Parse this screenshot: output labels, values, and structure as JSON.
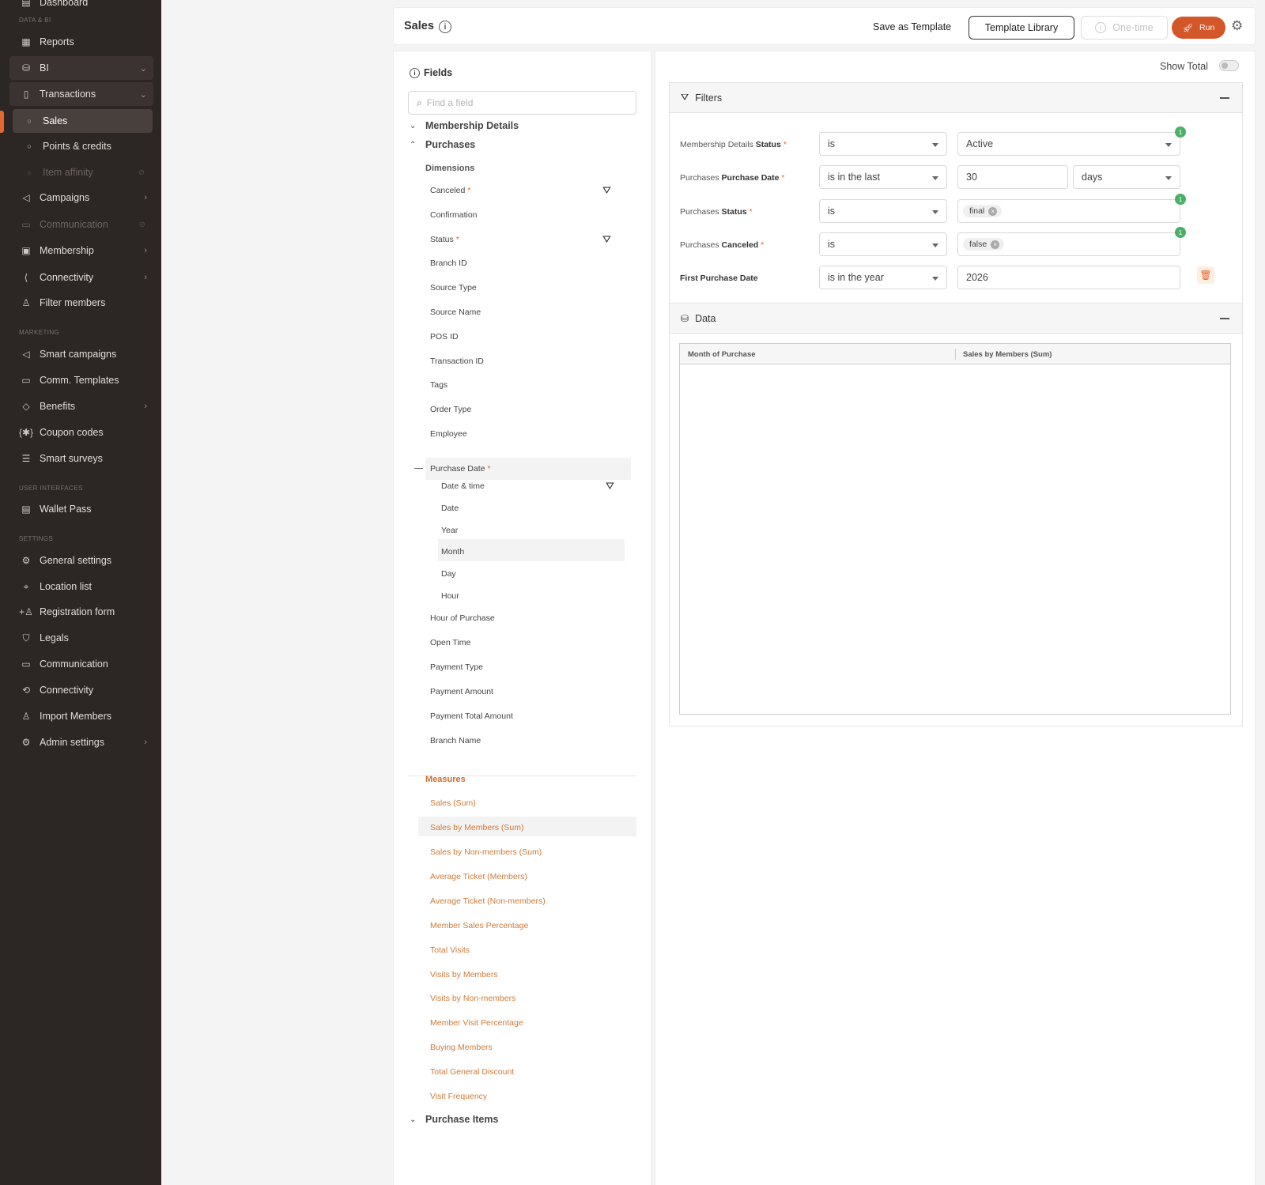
{
  "sidebar": {
    "top_item": "Dashboard",
    "sections": {
      "data_bi": "DATA & BI",
      "marketing": "MARKETING",
      "user_interfaces": "USER INTERFACES",
      "settings": "SETTINGS"
    },
    "items": {
      "reports": "Reports",
      "bi": "BI",
      "transactions": "Transactions",
      "sales": "Sales",
      "points_credits": "Points & credits",
      "item_affinity": "Item affinity",
      "campaigns": "Campaigns",
      "communication_bi": "Communication",
      "membership": "Membership",
      "connectivity_bi": "Connectivity",
      "filter_members": "Filter members",
      "smart_campaigns": "Smart campaigns",
      "comm_templates": "Comm. Templates",
      "benefits": "Benefits",
      "coupon_codes": "Coupon codes",
      "smart_surveys": "Smart surveys",
      "wallet_pass": "Wallet Pass",
      "general_settings": "General settings",
      "location_list": "Location list",
      "registration_form": "Registration form",
      "legals": "Legals",
      "communication": "Communication",
      "connectivity": "Connectivity",
      "import_members": "Import Members",
      "admin_settings": "Admin settings"
    },
    "accent_color": "#e0692f"
  },
  "header": {
    "title": "Sales",
    "save_template": "Save as Template",
    "template_library": "Template Library",
    "one_time": "One-time",
    "run": "Run"
  },
  "fields": {
    "title": "Fields",
    "search_placeholder": "Find a field",
    "groups": {
      "membership_details": "Membership Details",
      "purchases": "Purchases",
      "purchase_items": "Purchase Items"
    },
    "dimensions_label": "Dimensions",
    "dimensions": {
      "canceled": "Canceled",
      "confirmation": "Confirmation",
      "status": "Status",
      "branch_id": "Branch ID",
      "source_type": "Source Type",
      "source_name": "Source Name",
      "pos_id": "POS ID",
      "transaction_id": "Transaction ID",
      "tags": "Tags",
      "order_type": "Order Type",
      "employee": "Employee",
      "purchase_date": "Purchase Date",
      "date_time": "Date & time",
      "date": "Date",
      "year": "Year",
      "month": "Month",
      "day": "Day",
      "hour": "Hour",
      "hour_of_purchase": "Hour of Purchase",
      "open_time": "Open Time",
      "payment_type": "Payment Type",
      "payment_amount": "Payment Amount",
      "payment_total_amount": "Payment Total Amount",
      "branch_name": "Branch Name"
    },
    "measures_label": "Measures",
    "measures": [
      "Sales (Sum)",
      "Sales by Members (Sum)",
      "Sales by Non-members (Sum)",
      "Average Ticket (Members)",
      "Average Ticket (Non-members)",
      "Member Sales Percentage",
      "Total Visits",
      "Visits by Members",
      "Visits by Non-members",
      "Member Visit Percentage",
      "Buying Members",
      "Total General Discount",
      "Visit Frequency"
    ],
    "required_mark": "*"
  },
  "report": {
    "show_total": "Show Total",
    "filters_title": "Filters",
    "data_title": "Data",
    "filters": [
      {
        "prefix": "Membership Details ",
        "field": "Status",
        "required": "*",
        "operator": "is",
        "value": "Active",
        "badge": "1"
      },
      {
        "prefix": "Purchases ",
        "field": "Purchase Date",
        "required": "*",
        "operator": "is in the last",
        "value": "30",
        "unit": "days"
      },
      {
        "prefix": "Purchases ",
        "field": "Status",
        "required": "*",
        "operator": "is",
        "chip": "final",
        "badge": "1"
      },
      {
        "prefix": "Purchases ",
        "field": "Canceled",
        "required": "*",
        "operator": "is",
        "chip": "false",
        "badge": "1"
      },
      {
        "prefix": "",
        "field": "First Purchase Date",
        "required": "",
        "operator": "is in the year",
        "value": "2026"
      }
    ],
    "table": {
      "columns": [
        "Month of Purchase",
        "Sales by Members (Sum)"
      ]
    }
  }
}
